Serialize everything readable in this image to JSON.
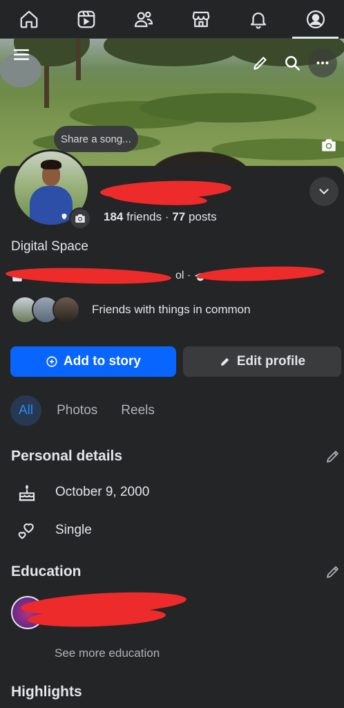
{
  "nav": {
    "items": [
      {
        "name": "home",
        "icon": "home-icon"
      },
      {
        "name": "video",
        "icon": "video-icon"
      },
      {
        "name": "friends",
        "icon": "friends-icon"
      },
      {
        "name": "marketplace",
        "icon": "marketplace-icon"
      },
      {
        "name": "notifications",
        "icon": "bell-icon"
      },
      {
        "name": "profile",
        "icon": "profile-icon",
        "active": true
      }
    ]
  },
  "cover": {
    "actions": [
      "menu-icon",
      "pencil-icon",
      "search-icon",
      "more-icon",
      "camera-icon"
    ]
  },
  "profile": {
    "song_prompt": "Share a song...",
    "friends_count": "184",
    "friends_label": "friends",
    "separator": "·",
    "posts_count": "77",
    "posts_label": "posts",
    "bio": "Digital Space",
    "work_visible_fragment": "ol ·",
    "mutual_text": "Friends with things in common"
  },
  "actions": {
    "add_story": "Add to story",
    "edit_profile": "Edit profile"
  },
  "tabs": [
    {
      "label": "All",
      "active": true
    },
    {
      "label": "Photos"
    },
    {
      "label": "Reels"
    }
  ],
  "personal": {
    "title": "Personal details",
    "birthday": "October 9, 2000",
    "relationship": "Single"
  },
  "education": {
    "title": "Education",
    "see_more": "See more education"
  },
  "highlights": {
    "title": "Highlights"
  },
  "colors": {
    "background": "#242526",
    "primary_button": "#0866ff",
    "active_tab_bg": "#263951",
    "active_tab_text": "#2d88ff",
    "redaction": "#ee2b2b"
  }
}
